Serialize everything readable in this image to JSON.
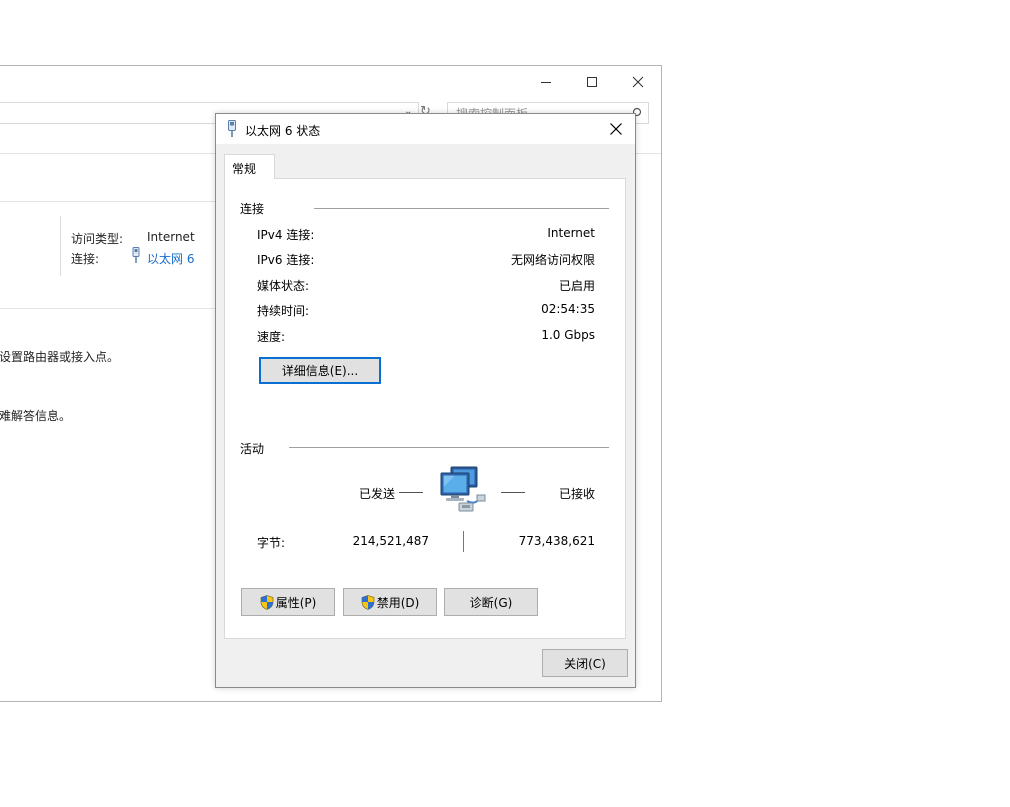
{
  "background_window": {
    "search_placeholder": "搜索控制面板",
    "access_type_label": "访问类型:",
    "access_type_value": "Internet",
    "connections_label": "连接:",
    "connection_name": "以太网 6",
    "text_line_1": "设置路由器或接入点。",
    "text_line_2": "难解答信息。"
  },
  "dialog": {
    "title": "以太网 6 状态",
    "tab": "常规",
    "connection_group": {
      "title": "连接",
      "rows": [
        {
          "label": "IPv4 连接:",
          "value": "Internet"
        },
        {
          "label": "IPv6 连接:",
          "value": "无网络访问权限"
        },
        {
          "label": "媒体状态:",
          "value": "已启用"
        },
        {
          "label": "持续时间:",
          "value": "02:54:35"
        },
        {
          "label": "速度:",
          "value": "1.0 Gbps"
        }
      ],
      "details_button": "详细信息(E)..."
    },
    "activity_group": {
      "title": "活动",
      "sent_label": "已发送",
      "received_label": "已接收",
      "bytes_label": "字节:",
      "bytes_sent": "214,521,487",
      "bytes_received": "773,438,621"
    },
    "buttons": {
      "properties": "属性(P)",
      "disable": "禁用(D)",
      "diagnose": "诊断(G)",
      "close": "关闭(C)"
    }
  },
  "colors": {
    "accent_border": "#0a6fd1",
    "link_blue": "#1a6dc6",
    "button_face": "#e1e1e1"
  },
  "icons": [
    "ethernet-plug-icon",
    "network-computers-icon",
    "uac-shield-icon",
    "close-icon",
    "minimize-icon",
    "maximize-icon",
    "search-icon",
    "refresh-icon"
  ]
}
